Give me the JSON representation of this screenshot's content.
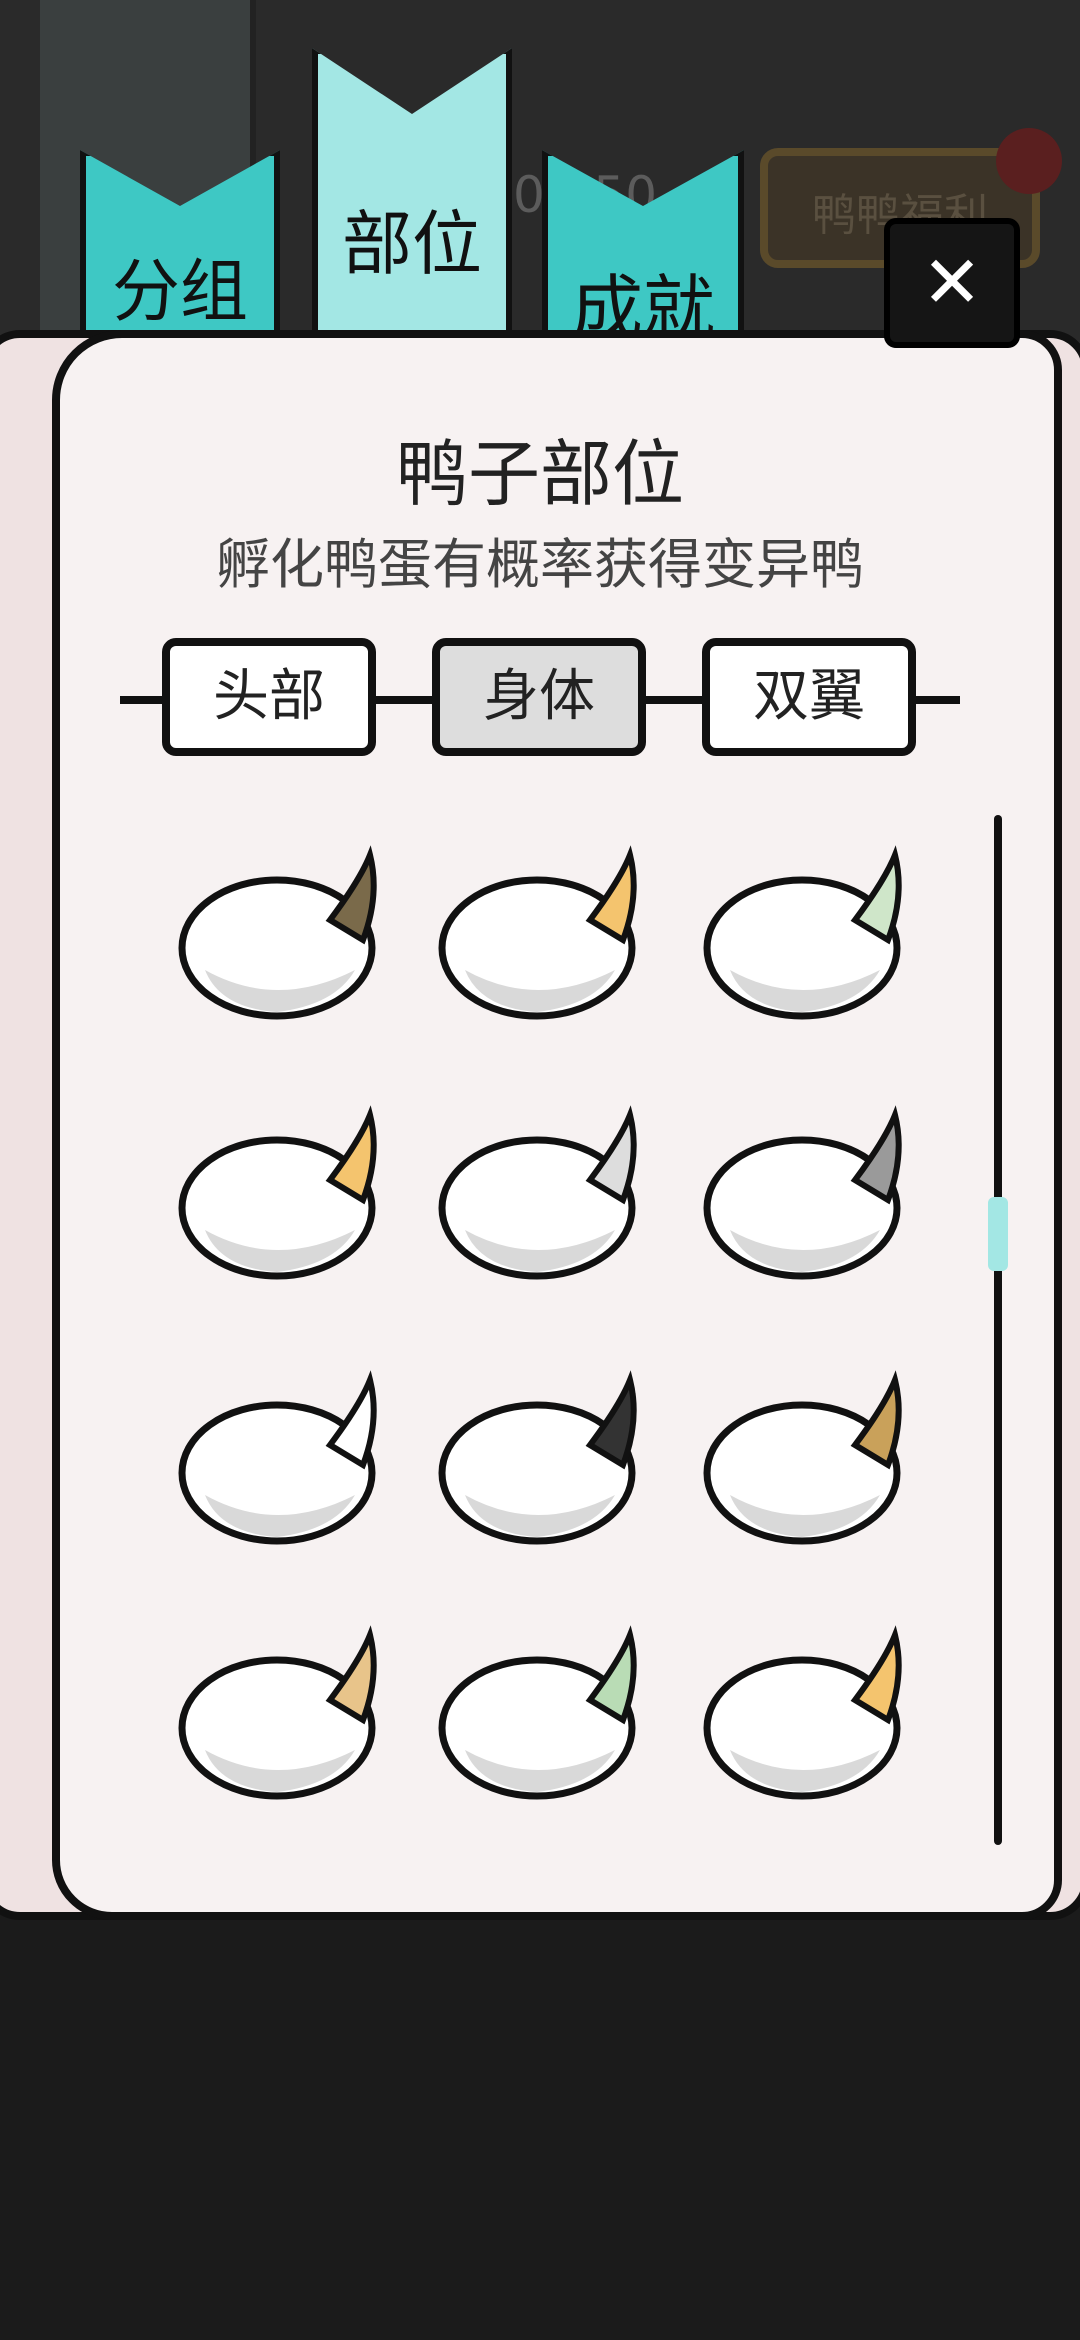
{
  "background": {
    "counter_text": "0/150",
    "welfare_label": "鸭鸭福利"
  },
  "tabs": [
    {
      "label": "分组",
      "active": false
    },
    {
      "label": "部位",
      "active": true
    },
    {
      "label": "成就",
      "active": false
    }
  ],
  "close_button": {
    "icon": "close-icon",
    "symbol": "✕"
  },
  "panel": {
    "title": "鸭子部位",
    "subtitle": "孵化鸭蛋有概率获得变异鸭"
  },
  "segments": [
    {
      "label": "头部",
      "active": false
    },
    {
      "label": "身体",
      "active": true
    },
    {
      "label": "双翼",
      "active": false
    }
  ],
  "parts_grid": [
    {
      "name": "body-arrow-tail",
      "accent": "#7a6a4a"
    },
    {
      "name": "body-hand",
      "accent": "#f4c46e"
    },
    {
      "name": "body-cracked-egg",
      "accent": "#cfe6c9"
    },
    {
      "name": "body-flame-tail",
      "accent": "#f4c46e"
    },
    {
      "name": "body-cloak",
      "accent": "#dddddd"
    },
    {
      "name": "body-spiky",
      "accent": "#9a9a9a"
    },
    {
      "name": "body-stitched-fluff",
      "accent": "#ffffff"
    },
    {
      "name": "body-dark-tail",
      "accent": "#333333"
    },
    {
      "name": "body-bound",
      "accent": "#c9a15a"
    },
    {
      "name": "body-bandaged",
      "accent": "#e8c48a"
    },
    {
      "name": "body-green-shell",
      "accent": "#b9dcb5"
    },
    {
      "name": "body-orange-spotted",
      "accent": "#f4c46e"
    }
  ],
  "scroll": {
    "position": 0.4
  }
}
